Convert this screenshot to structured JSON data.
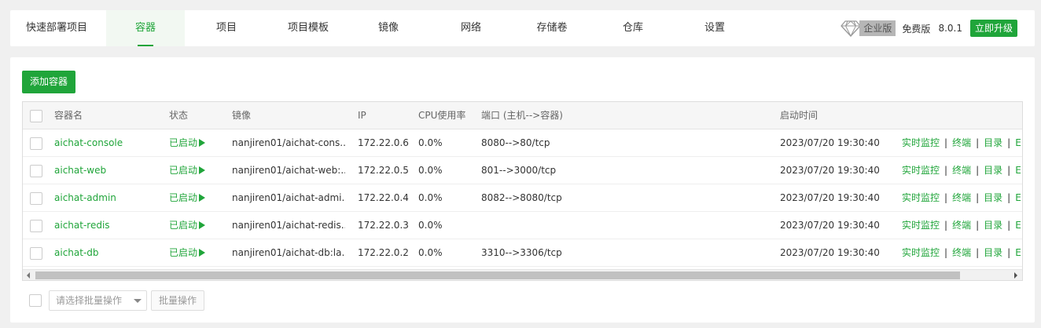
{
  "tabs": [
    {
      "label": "快速部署项目"
    },
    {
      "label": "容器"
    },
    {
      "label": "项目"
    },
    {
      "label": "项目模板"
    },
    {
      "label": "镜像"
    },
    {
      "label": "网络"
    },
    {
      "label": "存储卷"
    },
    {
      "label": "仓库"
    },
    {
      "label": "设置"
    }
  ],
  "active_tab": "容器",
  "edition": {
    "enterprise": "企业版",
    "free": "免费版",
    "version": "8.0.1",
    "upgrade": "立即升级"
  },
  "toolbar": {
    "add_label": "添加容器"
  },
  "table": {
    "headers": {
      "name": "容器名",
      "status": "状态",
      "image": "镜像",
      "ip": "IP",
      "cpu": "CPU使用率",
      "port": "端口 (主机-->容器)",
      "time": "启动时间"
    },
    "rows": [
      {
        "name": "aichat-console",
        "status": "已启动",
        "image": "nanjiren01/aichat-cons...",
        "ip": "172.22.0.6",
        "cpu": "0.0%",
        "port": "8080-->80/tcp",
        "time": "2023/07/20 19:30:40"
      },
      {
        "name": "aichat-web",
        "status": "已启动",
        "image": "nanjiren01/aichat-web:...",
        "ip": "172.22.0.5",
        "cpu": "0.0%",
        "port": "801-->3000/tcp",
        "time": "2023/07/20 19:30:40"
      },
      {
        "name": "aichat-admin",
        "status": "已启动",
        "image": "nanjiren01/aichat-admi...",
        "ip": "172.22.0.4",
        "cpu": "0.0%",
        "port": "8082-->8080/tcp",
        "time": "2023/07/20 19:30:40"
      },
      {
        "name": "aichat-redis",
        "status": "已启动",
        "image": "nanjiren01/aichat-redis...",
        "ip": "172.22.0.3",
        "cpu": "0.0%",
        "port": "",
        "time": "2023/07/20 19:30:40"
      },
      {
        "name": "aichat-db",
        "status": "已启动",
        "image": "nanjiren01/aichat-db:la...",
        "ip": "172.22.0.2",
        "cpu": "0.0%",
        "port": "3310-->3306/tcp",
        "time": "2023/07/20 19:30:40"
      }
    ],
    "ops": {
      "monitor": "实时监控",
      "terminal": "终端",
      "dir": "目录",
      "sep": "|",
      "more": "E"
    }
  },
  "batch": {
    "placeholder": "请选择批量操作",
    "button": "批量操作"
  },
  "colors": {
    "accent": "#20a53a"
  },
  "icons": {
    "edition": "diamond-icon",
    "status": "play-icon"
  }
}
